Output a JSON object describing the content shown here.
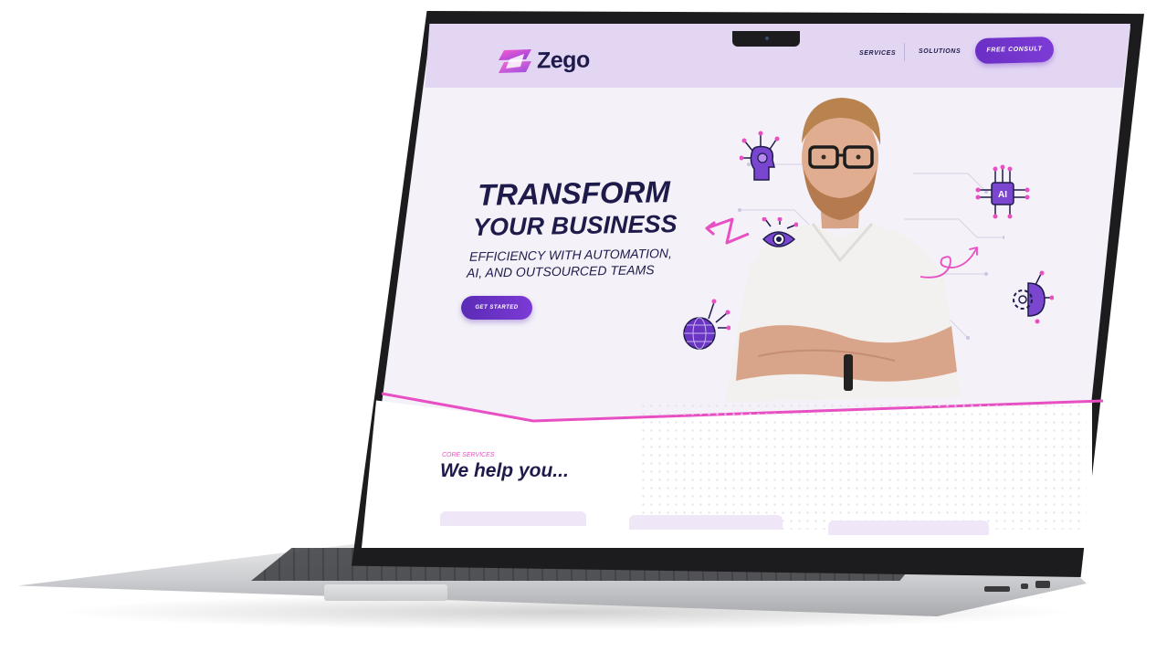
{
  "brand": {
    "name": "Zego",
    "accent": "#6a2fc4",
    "pink": "#e84fc3",
    "navy": "#1e1b4b"
  },
  "nav": {
    "links": [
      "SERVICES",
      "SOLUTIONS"
    ],
    "cta": "FREE CONSULT"
  },
  "hero": {
    "title_line1": "TRANSFORM",
    "title_line2": "YOUR BUSINESS",
    "subtitle_line1": "EFFICIENCY WITH AUTOMATION,",
    "subtitle_line2": "AI, AND OUTSOURCED TEAMS",
    "cta": "GET STARTED"
  },
  "services": {
    "eyebrow": "CORE SERVICES",
    "heading": "We help you..."
  },
  "icons": [
    "brain-gear-icon",
    "eye-chip-icon",
    "ai-chip-icon",
    "globe-icon",
    "brain-gear-half-icon",
    "zigzag-arrow-icon",
    "loop-arrow-icon"
  ]
}
